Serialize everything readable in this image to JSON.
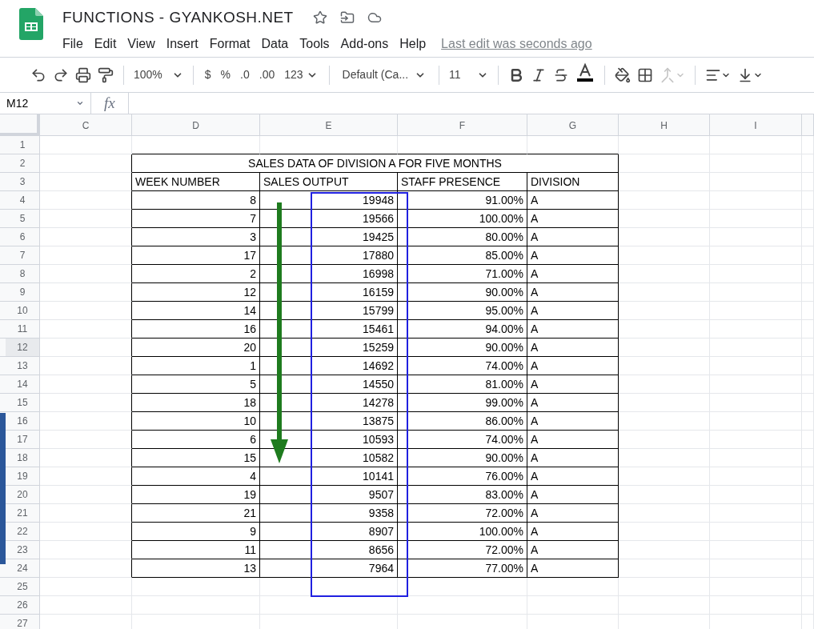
{
  "document": {
    "title": "FUNCTIONS - GYANKOSH.NET",
    "last_edit": "Last edit was seconds ago"
  },
  "menu": [
    "File",
    "Edit",
    "View",
    "Insert",
    "Format",
    "Data",
    "Tools",
    "Add-ons",
    "Help"
  ],
  "toolbar": {
    "zoom": "100%",
    "currency": "$",
    "percent": "%",
    "decrease_decimals": ".0",
    "increase_decimals": ".00",
    "more_formats": "123",
    "font": "Default (Ca...",
    "font_size": "11",
    "merge_disabled": true
  },
  "formula_bar": {
    "cell_reference": "M12",
    "fx": "fx"
  },
  "columns": [
    "C",
    "D",
    "E",
    "F",
    "G",
    "H",
    "I"
  ],
  "row_headers": [
    {
      "label": "1",
      "selected": false
    },
    {
      "label": "2",
      "selected": false
    },
    {
      "label": "3",
      "selected": false
    },
    {
      "label": "4",
      "selected": false
    },
    {
      "label": "5",
      "selected": false
    },
    {
      "label": "6",
      "selected": false
    },
    {
      "label": "7",
      "selected": false
    },
    {
      "label": "8",
      "selected": false
    },
    {
      "label": "9",
      "selected": false
    },
    {
      "label": "10",
      "selected": false
    },
    {
      "label": "11",
      "selected": false
    },
    {
      "label": "12",
      "selected": true
    },
    {
      "label": "13",
      "selected": false
    },
    {
      "label": "14",
      "selected": false
    },
    {
      "label": "15",
      "selected": false
    },
    {
      "label": "16",
      "selected": false
    },
    {
      "label": "17",
      "selected": false
    },
    {
      "label": "18",
      "selected": false
    },
    {
      "label": "19",
      "selected": false
    },
    {
      "label": "20",
      "selected": false
    },
    {
      "label": "21",
      "selected": false
    },
    {
      "label": "22",
      "selected": false
    },
    {
      "label": "23",
      "selected": false
    },
    {
      "label": "24",
      "selected": false
    },
    {
      "label": "25",
      "selected": false
    },
    {
      "label": "26",
      "selected": false
    },
    {
      "label": "27",
      "selected": false
    }
  ],
  "table": {
    "title": "SALES DATA OF DIVISION A FOR FIVE MONTHS",
    "headers": [
      "WEEK NUMBER",
      "SALES OUTPUT",
      "STAFF PRESENCE",
      "DIVISION"
    ],
    "rows": [
      [
        "8",
        "19948",
        "91.00%",
        "A"
      ],
      [
        "7",
        "19566",
        "100.00%",
        "A"
      ],
      [
        "3",
        "19425",
        "80.00%",
        "A"
      ],
      [
        "17",
        "17880",
        "85.00%",
        "A"
      ],
      [
        "2",
        "16998",
        "71.00%",
        "A"
      ],
      [
        "12",
        "16159",
        "90.00%",
        "A"
      ],
      [
        "14",
        "15799",
        "95.00%",
        "A"
      ],
      [
        "16",
        "15461",
        "94.00%",
        "A"
      ],
      [
        "20",
        "15259",
        "90.00%",
        "A"
      ],
      [
        "1",
        "14692",
        "74.00%",
        "A"
      ],
      [
        "5",
        "14550",
        "81.00%",
        "A"
      ],
      [
        "18",
        "14278",
        "99.00%",
        "A"
      ],
      [
        "10",
        "13875",
        "86.00%",
        "A"
      ],
      [
        "6",
        "10593",
        "74.00%",
        "A"
      ],
      [
        "15",
        "10582",
        "90.00%",
        "A"
      ],
      [
        "4",
        "10141",
        "76.00%",
        "A"
      ],
      [
        "19",
        "9507",
        "83.00%",
        "A"
      ],
      [
        "21",
        "9358",
        "72.00%",
        "A"
      ],
      [
        "9",
        "8907",
        "100.00%",
        "A"
      ],
      [
        "11",
        "8656",
        "72.00%",
        "A"
      ],
      [
        "13",
        "7964",
        "77.00%",
        "A"
      ]
    ]
  }
}
